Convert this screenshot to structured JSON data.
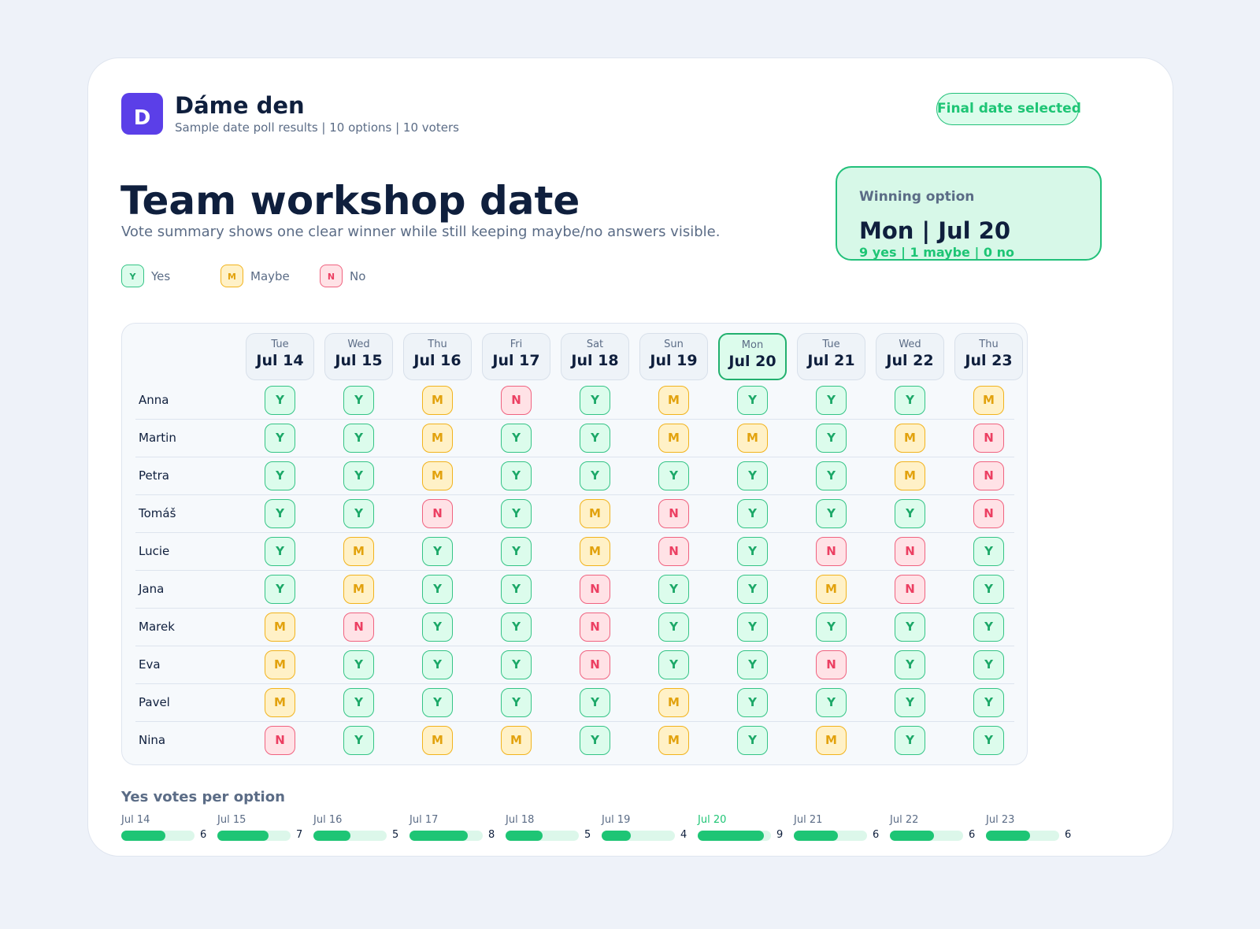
{
  "app": {
    "logo_letter": "D",
    "title": "Dáme den",
    "subtitle": "Sample date poll results | 10 options | 10 voters",
    "status": "Final date selected"
  },
  "page": {
    "title": "Team workshop date",
    "subtitle": "Vote summary shows one clear winner while still keeping maybe/no answers visible."
  },
  "winner": {
    "label": "Winning option",
    "date": "Mon | Jul 20",
    "stats": "9 yes | 1 maybe | 0 no"
  },
  "legend": [
    {
      "code": "Y",
      "label": "Yes",
      "type": "y"
    },
    {
      "code": "M",
      "label": "Maybe",
      "type": "m"
    },
    {
      "code": "N",
      "label": "No",
      "type": "n"
    }
  ],
  "options": [
    {
      "dow": "Tue",
      "date": "Jul 14",
      "winner": false
    },
    {
      "dow": "Wed",
      "date": "Jul 15",
      "winner": false
    },
    {
      "dow": "Thu",
      "date": "Jul 16",
      "winner": false
    },
    {
      "dow": "Fri",
      "date": "Jul 17",
      "winner": false
    },
    {
      "dow": "Sat",
      "date": "Jul 18",
      "winner": false
    },
    {
      "dow": "Sun",
      "date": "Jul 19",
      "winner": false
    },
    {
      "dow": "Mon",
      "date": "Jul 20",
      "winner": true
    },
    {
      "dow": "Tue",
      "date": "Jul 21",
      "winner": false
    },
    {
      "dow": "Wed",
      "date": "Jul 22",
      "winner": false
    },
    {
      "dow": "Thu",
      "date": "Jul 23",
      "winner": false
    }
  ],
  "voters": [
    {
      "name": "Anna",
      "votes": [
        "Y",
        "Y",
        "M",
        "N",
        "Y",
        "M",
        "Y",
        "Y",
        "Y",
        "M"
      ]
    },
    {
      "name": "Martin",
      "votes": [
        "Y",
        "Y",
        "M",
        "Y",
        "Y",
        "M",
        "M",
        "Y",
        "M",
        "N"
      ]
    },
    {
      "name": "Petra",
      "votes": [
        "Y",
        "Y",
        "M",
        "Y",
        "Y",
        "Y",
        "Y",
        "Y",
        "M",
        "N"
      ]
    },
    {
      "name": "Tomáš",
      "votes": [
        "Y",
        "Y",
        "N",
        "Y",
        "M",
        "N",
        "Y",
        "Y",
        "Y",
        "N"
      ]
    },
    {
      "name": "Lucie",
      "votes": [
        "Y",
        "M",
        "Y",
        "Y",
        "M",
        "N",
        "Y",
        "N",
        "N",
        "Y"
      ]
    },
    {
      "name": "Jana",
      "votes": [
        "Y",
        "M",
        "Y",
        "Y",
        "N",
        "Y",
        "Y",
        "M",
        "N",
        "Y"
      ]
    },
    {
      "name": "Marek",
      "votes": [
        "M",
        "N",
        "Y",
        "Y",
        "N",
        "Y",
        "Y",
        "Y",
        "Y",
        "Y"
      ]
    },
    {
      "name": "Eva",
      "votes": [
        "M",
        "Y",
        "Y",
        "Y",
        "N",
        "Y",
        "Y",
        "N",
        "Y",
        "Y"
      ]
    },
    {
      "name": "Pavel",
      "votes": [
        "M",
        "Y",
        "Y",
        "Y",
        "Y",
        "M",
        "Y",
        "Y",
        "Y",
        "Y"
      ]
    },
    {
      "name": "Nina",
      "votes": [
        "N",
        "Y",
        "M",
        "M",
        "Y",
        "M",
        "Y",
        "M",
        "Y",
        "Y"
      ]
    }
  ],
  "yes_counts": {
    "title": "Yes votes per option",
    "max": 10,
    "items": [
      {
        "label": "Jul 14",
        "count": 6,
        "winner": false
      },
      {
        "label": "Jul 15",
        "count": 7,
        "winner": false
      },
      {
        "label": "Jul 16",
        "count": 5,
        "winner": false
      },
      {
        "label": "Jul 17",
        "count": 8,
        "winner": false
      },
      {
        "label": "Jul 18",
        "count": 5,
        "winner": false
      },
      {
        "label": "Jul 19",
        "count": 4,
        "winner": false
      },
      {
        "label": "Jul 20",
        "count": 9,
        "winner": true
      },
      {
        "label": "Jul 21",
        "count": 6,
        "winner": false
      },
      {
        "label": "Jul 22",
        "count": 6,
        "winner": false
      },
      {
        "label": "Jul 23",
        "count": 6,
        "winner": false
      }
    ]
  },
  "colors": {
    "accent": "#5b3fe8",
    "yes": "#1ec575",
    "maybe": "#f2b31c",
    "no": "#ec3f62"
  }
}
